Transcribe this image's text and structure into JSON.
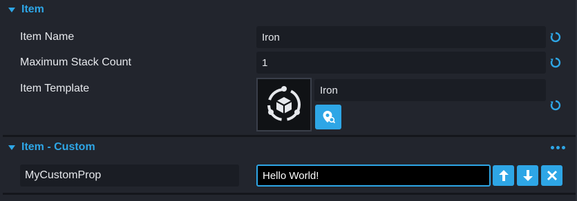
{
  "item_section": {
    "title": "Item",
    "name_label": "Item Name",
    "name_value": "Iron",
    "stack_label": "Maximum Stack Count",
    "stack_value": "1",
    "template_label": "Item Template",
    "template_value": "Iron"
  },
  "custom_section": {
    "title": "Item - Custom",
    "prop_name": "MyCustomProp",
    "prop_value": "Hello World!"
  },
  "icons": {
    "reset": "reset-icon",
    "locate": "location-search-icon",
    "up": "arrow-up-icon",
    "down": "arrow-down-icon",
    "remove": "close-icon",
    "more": "more-dots-icon",
    "template": "template-cube-icon"
  },
  "colors": {
    "accent": "#2ea6e6",
    "background": "#22252d",
    "field": "#1a1d24"
  }
}
